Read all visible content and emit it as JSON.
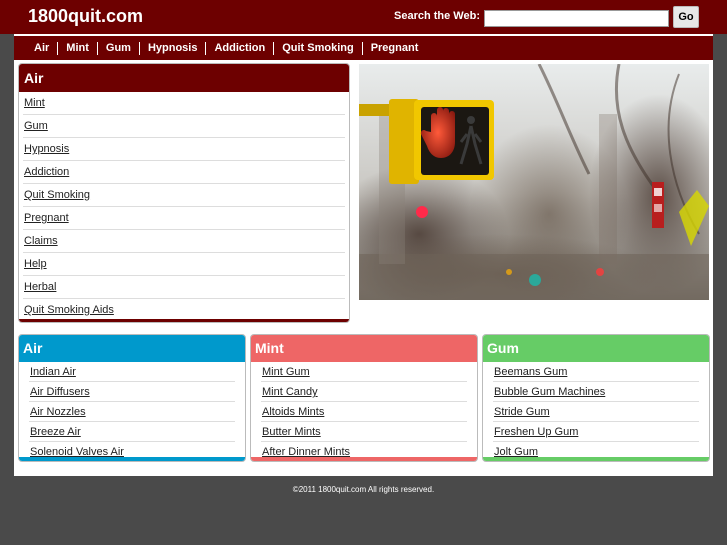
{
  "header": {
    "site_name": "1800quit.com",
    "search_label": "Search the Web:",
    "search_value": "",
    "go_label": "Go",
    "brand_color": "#6d0000"
  },
  "nav": {
    "items": [
      "Air",
      "Mint",
      "Gum",
      "Hypnosis",
      "Addiction",
      "Quit Smoking",
      "Pregnant"
    ]
  },
  "left_box": {
    "title": "Air",
    "links": [
      "Mint",
      "Gum",
      "Hypnosis",
      "Addiction",
      "Quit Smoking",
      "Pregnant",
      "Claims",
      "Help",
      "Herbal",
      "Quit Smoking Aids"
    ]
  },
  "boxes": {
    "air": {
      "title": "Air",
      "color": "#0099cc",
      "links": [
        "Indian Air",
        "Air Diffusers",
        "Air Nozzles",
        "Breeze Air",
        "Solenoid Valves Air"
      ]
    },
    "mint": {
      "title": "Mint",
      "color": "#ee6666",
      "links": [
        "Mint Gum",
        "Mint Candy",
        "Altoids Mints",
        "Butter Mints",
        "After Dinner Mints"
      ]
    },
    "gum": {
      "title": "Gum",
      "color": "#66cc66",
      "links": [
        "Beemans Gum",
        "Bubble Gum Machines",
        "Stride Gum",
        "Freshen Up Gum",
        "Jolt Gum"
      ]
    }
  },
  "footer": {
    "copyright": "©2011 1800quit.com All rights reserved."
  }
}
